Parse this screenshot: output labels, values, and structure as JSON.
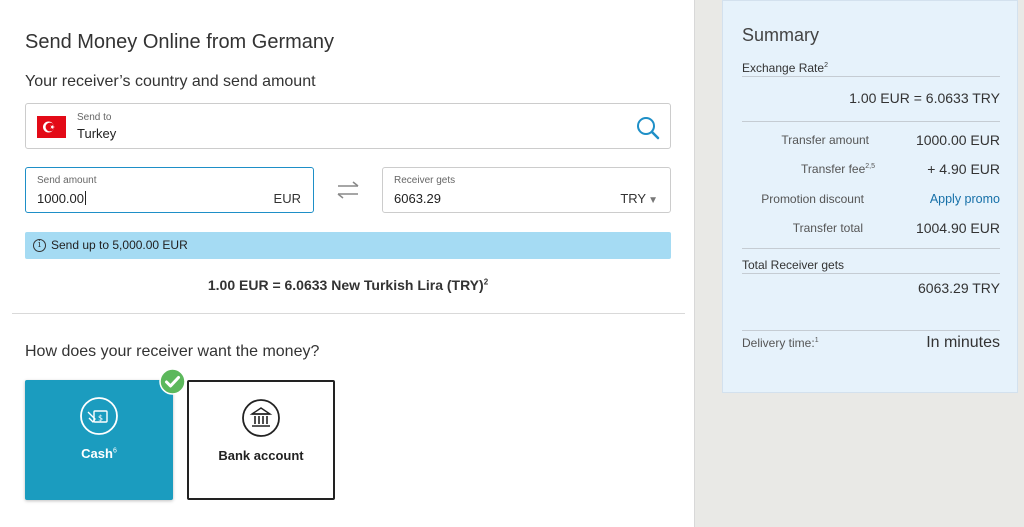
{
  "form": {
    "title": "Send Money Online from Germany",
    "section_title": "Your receiver’s country and send amount",
    "country": {
      "label": "Send to",
      "value": "Turkey"
    },
    "send": {
      "label": "Send amount",
      "value": "1000.00",
      "currency": "EUR"
    },
    "receive": {
      "label": "Receiver gets",
      "value": "6063.29",
      "currency": "TRY"
    },
    "info": "Send up to 5,000.00 EUR",
    "rate": {
      "text": "1.00 EUR = 6.0633 New Turkish Lira (TRY)",
      "note": "2"
    },
    "method_title": "How does your receiver want the money?",
    "methods": [
      {
        "label": "Cash",
        "note": "6",
        "selected": true,
        "icon": "cash-hand-icon"
      },
      {
        "label": "Bank account",
        "selected": false,
        "icon": "bank-icon"
      }
    ]
  },
  "summary": {
    "title": "Summary",
    "exchange_rate_label": "Exchange Rate",
    "exchange_rate_note": "2",
    "exchange_rate_value": "1.00 EUR = 6.0633 TRY",
    "rows": [
      {
        "label": "Transfer amount",
        "note": "",
        "value": "1000.00  EUR"
      },
      {
        "label": "Transfer fee",
        "note": "2,5",
        "value": "+ 4.90  EUR"
      },
      {
        "label": "Promotion discount",
        "note": "",
        "value": "Apply promo"
      },
      {
        "label": "Transfer total",
        "note": "",
        "value": "1004.90  EUR"
      }
    ],
    "receiver_label": "Total Receiver gets",
    "receiver_value": "6063.29 TRY",
    "delivery_label": "Delivery time:",
    "delivery_note": "1",
    "delivery_value": "In minutes"
  },
  "colors": {
    "accent_blue": "#1e8fc7",
    "info_bar": "#a5dbf3",
    "cash_card": "#1b9cbf",
    "check_green": "#5cb85c",
    "summary_bg": "#e6f2fb"
  }
}
